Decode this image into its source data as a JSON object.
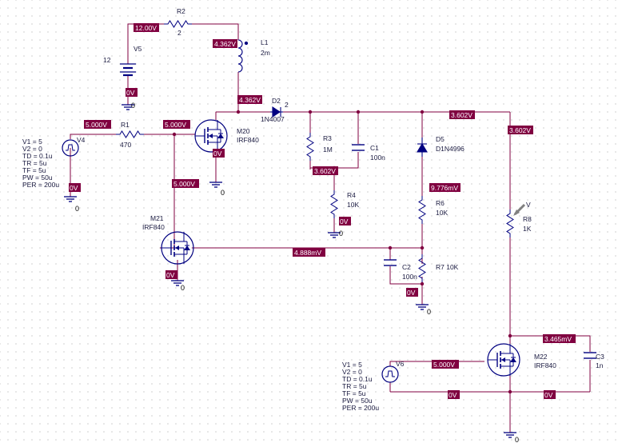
{
  "colors": {
    "wire": "#800040",
    "voltage_box": "#800040",
    "voltage_text": "#ffffff",
    "component": "#000080",
    "label": "#1a1a40",
    "probe": "#808080"
  },
  "sources": {
    "V5": {
      "name": "V5",
      "value": "12"
    },
    "V4": {
      "name": "V4",
      "params": [
        "V1 = 5",
        "V2 = 0",
        "TD = 0.1u",
        "TR = 5u",
        "TF = 5u",
        "PW = 50u",
        "PER = 200u"
      ]
    },
    "V6": {
      "name": "V6",
      "params": [
        "V1 = 5",
        "V2 = 0",
        "TD = 0.1u",
        "TR = 5u",
        "TF = 5u",
        "PW = 50u",
        "PER = 200u"
      ]
    }
  },
  "components": {
    "R2": {
      "name": "R2",
      "value": "2"
    },
    "L1": {
      "name": "L1",
      "value": "2m"
    },
    "R1": {
      "name": "R1",
      "value": "470"
    },
    "D2": {
      "name": "D2",
      "value": "1N4007",
      "pin": "2"
    },
    "M20": {
      "name": "M20",
      "value": "IRF840"
    },
    "M21": {
      "name": "M21",
      "value": "IRF840"
    },
    "M22": {
      "name": "M22",
      "value": "IRF840"
    },
    "R3": {
      "name": "R3",
      "value": "1M"
    },
    "C1": {
      "name": "C1",
      "value": "100n"
    },
    "R4": {
      "name": "R4",
      "value": "10K"
    },
    "D5": {
      "name": "D5",
      "value": "D1N4996"
    },
    "R6": {
      "name": "R6",
      "value": "10K"
    },
    "R8": {
      "name": "R8",
      "value": "1K"
    },
    "C2": {
      "name": "C2",
      "value": "100n"
    },
    "R7": {
      "name": "R7 10K"
    },
    "C3": {
      "name": "C3",
      "value": "1n"
    }
  },
  "probe_label": "V",
  "ground_label": "0",
  "voltages": {
    "v_12": "12.00V",
    "v_l1_top": "4.362V",
    "v_v5_gnd": "0V",
    "v_l1_bot": "4.362V",
    "v_v4_out": "5.000V",
    "v_m20_gate": "5.000V",
    "v_m21_gate": "5.000V",
    "v_m20_src": "0V",
    "v_v4_gnd": "0V",
    "v_r3c1": "3.602V",
    "v_r4_gnd": "0V",
    "v_d5_top": "3.602V",
    "v_r8_top": "3.602V",
    "v_r6_top": "9.776mV",
    "v_m21_drain": "4.888mV",
    "v_m21_src": "0V",
    "v_c2_gnd": "0V",
    "v_m22_drain": "3.465mV",
    "v_v6_out": "5.000V",
    "v_v6_gnd": "0V",
    "v_m22_src": "0V"
  }
}
